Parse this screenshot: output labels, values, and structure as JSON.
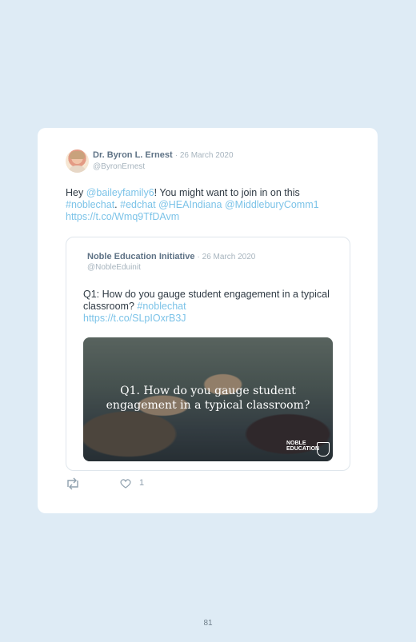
{
  "tweet": {
    "author_name": "Dr. Byron L. Ernest",
    "date": "26 March 2020",
    "handle": "@ByronErnest",
    "text_segments": {
      "hey": "Hey ",
      "mention_1": "@baileyfamily6",
      "t1": "! You might want to join in on this",
      "hashtag_1": "#noblechat",
      "t2": ". ",
      "hashtag_2": "#edchat",
      "t3": " ",
      "mention_2": "@HEAIndiana",
      "t4": " ",
      "mention_3": "@MiddleburyComm1",
      "url": "https://t.co/Wmq9TfDAvm"
    },
    "likes": "1"
  },
  "quoted_tweet": {
    "author_name": "Noble Education Initiative",
    "date": "26 March 2020",
    "handle": "@NobleEduinit",
    "text": "Q1: How do you gauge student engagement in a typical classroom?",
    "hashtag": "#noblechat",
    "url": "https://t.co/SLpIOxrB3J",
    "image_caption": "Q1. How do you gauge student engagement in a typical classroom?",
    "image_logo": "NOBLE EDUCATION"
  },
  "page": {
    "number": "81"
  },
  "colors": {
    "background": "#deebf5",
    "link": "#7cc3e8",
    "card": "#ffffff"
  },
  "icons": [
    "retweet-icon",
    "heart-icon"
  ]
}
